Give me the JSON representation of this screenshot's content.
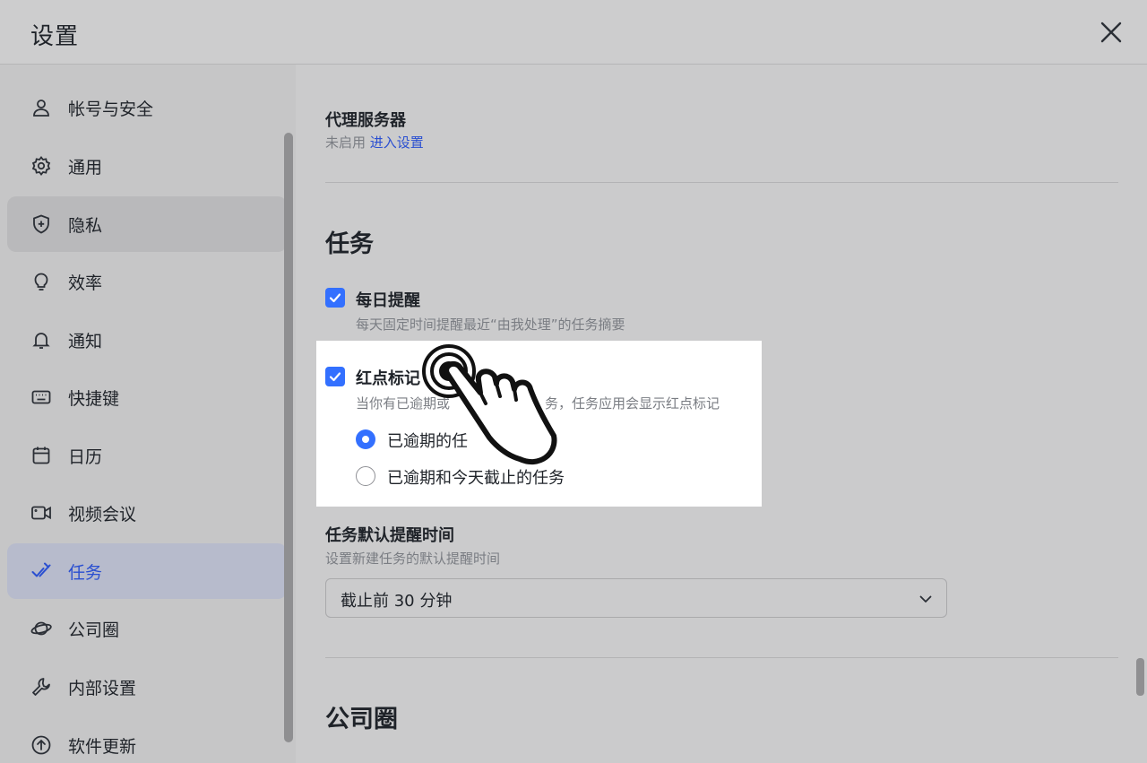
{
  "window": {
    "title": "设置"
  },
  "sidebar": {
    "items": [
      {
        "label": "帐号与安全",
        "icon": "user-icon"
      },
      {
        "label": "通用",
        "icon": "gear-icon"
      },
      {
        "label": "隐私",
        "icon": "shield-plus-icon"
      },
      {
        "label": "效率",
        "icon": "lightbulb-icon"
      },
      {
        "label": "通知",
        "icon": "bell-icon"
      },
      {
        "label": "快捷键",
        "icon": "keyboard-icon"
      },
      {
        "label": "日历",
        "icon": "calendar-icon"
      },
      {
        "label": "视频会议",
        "icon": "video-camera-icon"
      },
      {
        "label": "任务",
        "icon": "task-check-icon",
        "active": true
      },
      {
        "label": "公司圈",
        "icon": "planet-icon"
      },
      {
        "label": "内部设置",
        "icon": "wrench-icon"
      },
      {
        "label": "软件更新",
        "icon": "arrow-up-circle-icon"
      }
    ]
  },
  "proxy": {
    "title": "代理服务器",
    "status": "未启用",
    "link": "进入设置"
  },
  "tasks": {
    "section_title": "任务",
    "daily_reminder": {
      "label": "每日提醒",
      "description": "每天固定时间提醒最近“由我处理”的任务摘要",
      "checked": true
    },
    "red_dot": {
      "label": "红点标记",
      "description_left": "当你有已逾期或",
      "description_right": "务，任务应用会显示红点标记",
      "checked": true,
      "options": [
        {
          "label": "已逾期的任务",
          "visible_label": "已逾期的任",
          "selected": true
        },
        {
          "label": "已逾期和今天截止的任务",
          "selected": false
        }
      ]
    },
    "default_reminder": {
      "title": "任务默认提醒时间",
      "description": "设置新建任务的默认提醒时间",
      "selected": "截止前 30 分钟"
    }
  },
  "moments": {
    "section_title": "公司圈"
  },
  "overlay": {
    "icon": "tap-hand-icon"
  },
  "colors": {
    "accent": "#3370ff",
    "link": "#2a4fd1",
    "active_nav_bg": "#b7bbcc"
  }
}
